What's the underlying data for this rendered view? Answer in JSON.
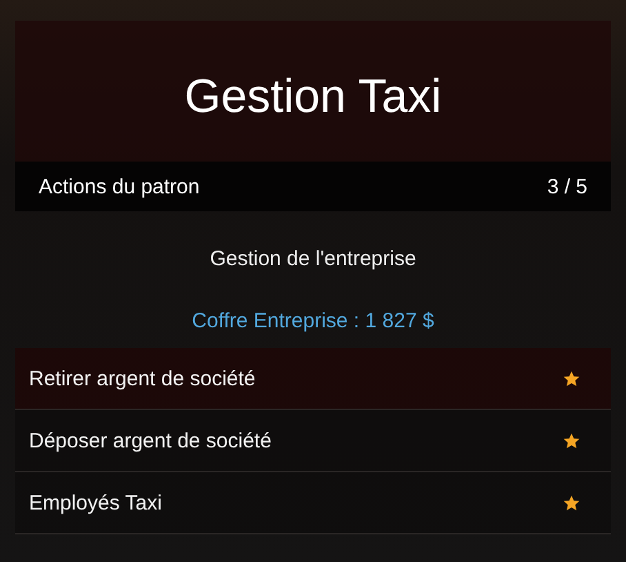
{
  "header": {
    "title": "Gestion Taxi"
  },
  "subtitle_bar": {
    "label": "Actions du patron",
    "counter": "3 / 5"
  },
  "section_title": "Gestion de l'entreprise",
  "balance": "Coffre Entreprise : 1 827 $",
  "items": [
    {
      "label": "Retirer argent de société",
      "selected": true
    },
    {
      "label": "Déposer argent de société",
      "selected": false
    },
    {
      "label": "Employés Taxi",
      "selected": false
    }
  ]
}
